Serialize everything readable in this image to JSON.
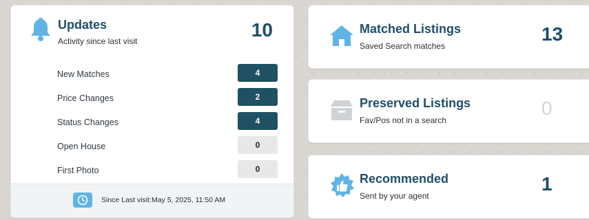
{
  "updates": {
    "title": "Updates",
    "subtitle": "Activity since last visit",
    "total": "10",
    "rows": [
      {
        "label": "New Matches",
        "count": "4",
        "variant": "dark"
      },
      {
        "label": "Price Changes",
        "count": "2",
        "variant": "dark"
      },
      {
        "label": "Status Changes",
        "count": "4",
        "variant": "dark"
      },
      {
        "label": "Open House",
        "count": "0",
        "variant": "light"
      },
      {
        "label": "First Photo",
        "count": "0",
        "variant": "light"
      }
    ],
    "footer": {
      "text": "Since Last visit:May 5, 2025, 11:50 AM",
      "icon": "clock-icon"
    }
  },
  "cards": {
    "matched": {
      "title": "Matched Listings",
      "subtitle": "Saved Search matches",
      "value": "13",
      "icon": "house-icon"
    },
    "preserved": {
      "title": "Preserved Listings",
      "subtitle": "Fav/Pos not in a search",
      "value": "0",
      "icon": "archive-box-icon"
    },
    "recommended": {
      "title": "Recommended",
      "subtitle": "Sent by your agent",
      "value": "1",
      "icon": "thumbs-up-badge-icon"
    }
  },
  "colors": {
    "accent": "#1f4e6b",
    "badge_dark": "#1f5063",
    "badge_light": "#e8e8e8",
    "icon_blue": "#5fb4e5",
    "icon_grey": "#cfd3d6",
    "muted_value": "#d1d5d8"
  }
}
